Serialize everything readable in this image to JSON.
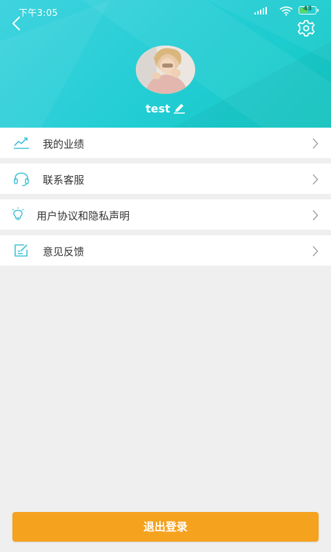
{
  "status_bar": {
    "time": "下午3:05",
    "battery_level": "43"
  },
  "profile": {
    "username": "test"
  },
  "menu": {
    "items": [
      {
        "label": "我的业绩",
        "icon": "trend-chart-icon"
      },
      {
        "label": "联系客服",
        "icon": "headset-icon"
      },
      {
        "label": "用户协议和隐私声明",
        "icon": "lightbulb-icon"
      },
      {
        "label": "意见反馈",
        "icon": "feedback-edit-icon"
      }
    ]
  },
  "logout": {
    "label": "退出登录"
  },
  "colors": {
    "header_gradient_start": "#3fd3df",
    "header_gradient_end": "#12c9c4",
    "accent_icon": "#3fc1d6",
    "logout_button": "#f5a21f",
    "page_background": "#efefef"
  }
}
